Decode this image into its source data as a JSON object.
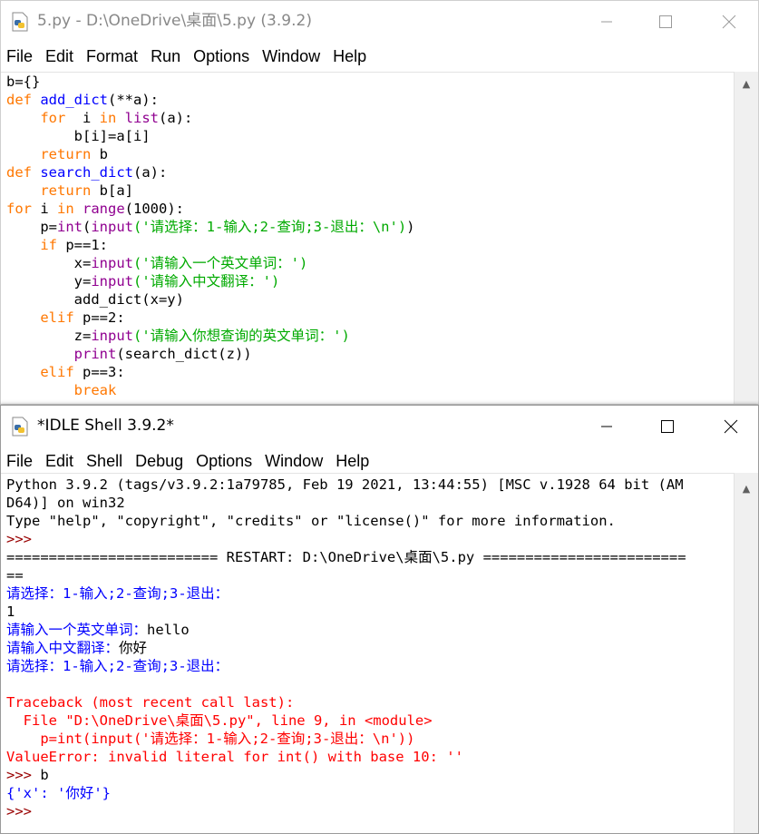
{
  "editor": {
    "title": "5.py - D:\\OneDrive\\桌面\\5.py (3.9.2)",
    "menu": [
      "File",
      "Edit",
      "Format",
      "Run",
      "Options",
      "Window",
      "Help"
    ]
  },
  "shell": {
    "title": "*IDLE Shell 3.9.2*",
    "menu": [
      "File",
      "Edit",
      "Shell",
      "Debug",
      "Options",
      "Window",
      "Help"
    ]
  },
  "colors": {
    "keyword": "#ff7700",
    "definition": "#0000ff",
    "builtin": "#900090",
    "string": "#00aa00",
    "stdout": "#0000ff",
    "stderr": "#ff0000",
    "prompt": "#990000"
  },
  "editor_lines": [
    [
      {
        "t": "b={}",
        "c": "df"
      }
    ],
    [
      {
        "t": "def ",
        "c": "kw"
      },
      {
        "t": "add_dict",
        "c": "fn"
      },
      {
        "t": "(**a):",
        "c": "df"
      }
    ],
    [
      {
        "t": "    for ",
        "c": "kw"
      },
      {
        "t": " i ",
        "c": "df"
      },
      {
        "t": "in ",
        "c": "kw"
      },
      {
        "t": "list",
        "c": "bi"
      },
      {
        "t": "(a):",
        "c": "df"
      }
    ],
    [
      {
        "t": "        b[i]=a[i]",
        "c": "df"
      }
    ],
    [
      {
        "t": "    return ",
        "c": "kw"
      },
      {
        "t": "b",
        "c": "df"
      }
    ],
    [
      {
        "t": "def ",
        "c": "kw"
      },
      {
        "t": "search_dict",
        "c": "fn"
      },
      {
        "t": "(a):",
        "c": "df"
      }
    ],
    [
      {
        "t": "    return ",
        "c": "kw"
      },
      {
        "t": "b[a]",
        "c": "df"
      }
    ],
    [
      {
        "t": "for ",
        "c": "kw"
      },
      {
        "t": "i ",
        "c": "df"
      },
      {
        "t": "in ",
        "c": "kw"
      },
      {
        "t": "range",
        "c": "bi"
      },
      {
        "t": "(1000):",
        "c": "df"
      }
    ],
    [
      {
        "t": "    p=",
        "c": "df"
      },
      {
        "t": "int",
        "c": "bi"
      },
      {
        "t": "(",
        "c": "df"
      },
      {
        "t": "input",
        "c": "bi"
      },
      {
        "t": "('请选择：1-输入;2-查询;3-退出：\\n')",
        "c": "st"
      },
      {
        "t": ")",
        "c": "df"
      }
    ],
    [
      {
        "t": "    if ",
        "c": "kw"
      },
      {
        "t": "p==1:",
        "c": "df"
      }
    ],
    [
      {
        "t": "        x=",
        "c": "df"
      },
      {
        "t": "input",
        "c": "bi"
      },
      {
        "t": "('请输入一个英文单词：')",
        "c": "st"
      }
    ],
    [
      {
        "t": "        y=",
        "c": "df"
      },
      {
        "t": "input",
        "c": "bi"
      },
      {
        "t": "('请输入中文翻译：')",
        "c": "st"
      }
    ],
    [
      {
        "t": "        add_dict(x=y)",
        "c": "df"
      }
    ],
    [
      {
        "t": "    elif ",
        "c": "kw"
      },
      {
        "t": "p==2:",
        "c": "df"
      }
    ],
    [
      {
        "t": "        z=",
        "c": "df"
      },
      {
        "t": "input",
        "c": "bi"
      },
      {
        "t": "('请输入你想查询的英文单词：')",
        "c": "st"
      }
    ],
    [
      {
        "t": "        ",
        "c": "df"
      },
      {
        "t": "print",
        "c": "bi"
      },
      {
        "t": "(search_dict(z))",
        "c": "df"
      }
    ],
    [
      {
        "t": "    elif ",
        "c": "kw"
      },
      {
        "t": "p==3:",
        "c": "df"
      }
    ],
    [
      {
        "t": "        break",
        "c": "kw"
      }
    ]
  ],
  "shell_lines": [
    [
      {
        "t": "Python 3.9.2 (tags/v3.9.2:1a79785, Feb 19 2021, 13:44:55) [MSC v.1928 64 bit (AM",
        "c": "df"
      }
    ],
    [
      {
        "t": "D64)] on win32",
        "c": "df"
      }
    ],
    [
      {
        "t": "Type \"help\", \"copyright\", \"credits\" or \"license()\" for more information.",
        "c": "df"
      }
    ],
    [
      {
        "t": ">>> ",
        "c": "prm"
      }
    ],
    [
      {
        "t": "========================= RESTART: D:\\OneDrive\\桌面\\5.py ========================",
        "c": "df"
      }
    ],
    [
      {
        "t": "==",
        "c": "df"
      }
    ],
    [
      {
        "t": "请选择：1-输入;2-查询;3-退出：",
        "c": "out"
      }
    ],
    [
      {
        "t": "1",
        "c": "df"
      }
    ],
    [
      {
        "t": "请输入一个英文单词：",
        "c": "out"
      },
      {
        "t": "hello",
        "c": "df"
      }
    ],
    [
      {
        "t": "请输入中文翻译：",
        "c": "out"
      },
      {
        "t": "你好",
        "c": "df"
      }
    ],
    [
      {
        "t": "请选择：1-输入;2-查询;3-退出：",
        "c": "out"
      }
    ],
    [
      {
        "t": "",
        "c": "df"
      }
    ],
    [
      {
        "t": "Traceback (most recent call last):",
        "c": "err"
      }
    ],
    [
      {
        "t": "  File \"D:\\OneDrive\\桌面\\5.py\", line 9, in <module>",
        "c": "err"
      }
    ],
    [
      {
        "t": "    p=int(input('请选择：1-输入;2-查询;3-退出：\\n'))",
        "c": "err"
      }
    ],
    [
      {
        "t": "ValueError: invalid literal for int() with base 10: ''",
        "c": "err"
      }
    ],
    [
      {
        "t": ">>> ",
        "c": "prm"
      },
      {
        "t": "b",
        "c": "df"
      }
    ],
    [
      {
        "t": "{'x': '你好'}",
        "c": "out"
      }
    ],
    [
      {
        "t": ">>> ",
        "c": "prm"
      }
    ]
  ]
}
